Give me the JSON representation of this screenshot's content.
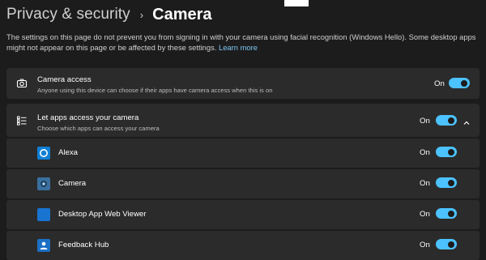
{
  "breadcrumb": {
    "parent": "Privacy & security",
    "separator": "›",
    "current": "Camera"
  },
  "notice": {
    "text": "The settings on this page do not prevent you from signing in with your camera using facial recognition (Windows Hello). Some desktop apps might not appear on this page or be affected by these settings.",
    "link": "Learn more"
  },
  "camera_access": {
    "title": "Camera access",
    "subtitle": "Anyone using this device can choose if their apps have camera access when this is on",
    "state": "On",
    "on": true,
    "icon": "camera-icon"
  },
  "let_apps": {
    "title": "Let apps access your camera",
    "subtitle": "Choose which apps can access your camera",
    "state": "On",
    "on": true,
    "icon": "list-icon",
    "expanded": true
  },
  "apps": [
    {
      "name": "Alexa",
      "state": "On",
      "on": true,
      "icon": "alexa-icon"
    },
    {
      "name": "Camera",
      "state": "On",
      "on": true,
      "icon": "camera-app-icon"
    },
    {
      "name": "Desktop App Web Viewer",
      "state": "On",
      "on": true,
      "icon": "desktop-app-web-viewer-icon"
    },
    {
      "name": "Feedback Hub",
      "state": "On",
      "on": true,
      "icon": "feedback-hub-icon"
    }
  ],
  "colors": {
    "accent": "#4cc2ff",
    "background": "#1c1c1c",
    "card": "#2b2b2b",
    "link": "#7ec6f5"
  }
}
